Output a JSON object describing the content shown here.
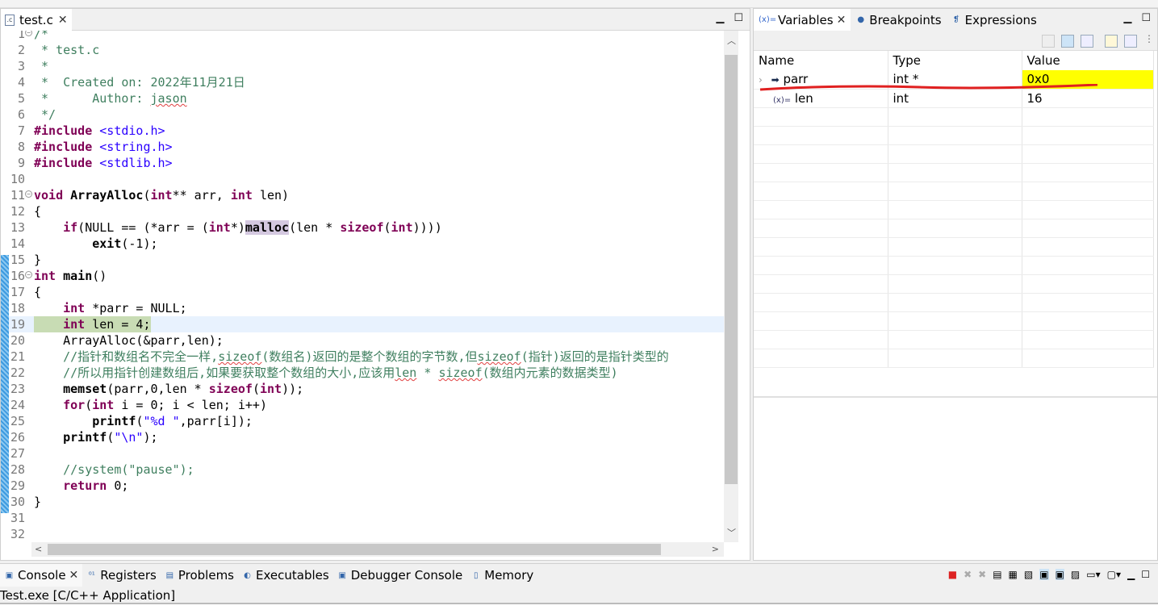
{
  "editor": {
    "tab_label": "test.c",
    "file_icon": "c-file-icon",
    "lines": [
      [
        {
          "c": "cm",
          "s": "/*"
        }
      ],
      [
        {
          "c": "cm",
          "s": " * test.c"
        }
      ],
      [
        {
          "c": "cm",
          "s": " *"
        }
      ],
      [
        {
          "c": "cm",
          "s": " *  Created on: 2022年11月21日"
        }
      ],
      [
        {
          "c": "cm",
          "s": " *      Author: "
        },
        {
          "c": "cm sq",
          "s": "jason"
        }
      ],
      [
        {
          "c": "cm",
          "s": " */"
        }
      ],
      [
        {
          "c": "kw",
          "s": "#include"
        },
        {
          "c": "",
          "s": " "
        },
        {
          "c": "st",
          "s": "<stdio.h>"
        }
      ],
      [
        {
          "c": "kw",
          "s": "#include"
        },
        {
          "c": "",
          "s": " "
        },
        {
          "c": "st",
          "s": "<string.h>"
        }
      ],
      [
        {
          "c": "kw",
          "s": "#include"
        },
        {
          "c": "",
          "s": " "
        },
        {
          "c": "st",
          "s": "<stdlib.h>"
        }
      ],
      [],
      [
        {
          "c": "kw",
          "s": "void"
        },
        {
          "c": "",
          "s": " "
        },
        {
          "c": "fn",
          "s": "ArrayAlloc"
        },
        {
          "c": "",
          "s": "("
        },
        {
          "c": "kw",
          "s": "int"
        },
        {
          "c": "",
          "s": "** arr, "
        },
        {
          "c": "kw",
          "s": "int"
        },
        {
          "c": "",
          "s": " len)"
        }
      ],
      [
        {
          "c": "",
          "s": "{"
        }
      ],
      [
        {
          "c": "",
          "s": "    "
        },
        {
          "c": "kw",
          "s": "if"
        },
        {
          "c": "",
          "s": "(NULL == (*arr = ("
        },
        {
          "c": "kw",
          "s": "int"
        },
        {
          "c": "",
          "s": "*)"
        },
        {
          "c": "fn hl",
          "s": "malloc"
        },
        {
          "c": "",
          "s": "(len * "
        },
        {
          "c": "kw",
          "s": "sizeof"
        },
        {
          "c": "",
          "s": "("
        },
        {
          "c": "kw",
          "s": "int"
        },
        {
          "c": "",
          "s": "))))"
        }
      ],
      [
        {
          "c": "",
          "s": "        "
        },
        {
          "c": "fn",
          "s": "exit"
        },
        {
          "c": "",
          "s": "(-1);"
        }
      ],
      [
        {
          "c": "",
          "s": "}"
        }
      ],
      [
        {
          "c": "kw",
          "s": "int"
        },
        {
          "c": "",
          "s": " "
        },
        {
          "c": "fn",
          "s": "main"
        },
        {
          "c": "",
          "s": "()"
        }
      ],
      [
        {
          "c": "",
          "s": "{"
        }
      ],
      [
        {
          "c": "",
          "s": "    "
        },
        {
          "c": "kw",
          "s": "int"
        },
        {
          "c": "",
          "s": " *parr = NULL;"
        }
      ],
      [
        {
          "c": "",
          "s": "    "
        },
        {
          "c": "kw",
          "s": "int"
        },
        {
          "c": "",
          "s": " len = 4;"
        }
      ],
      [
        {
          "c": "",
          "s": "    ArrayAlloc(&parr,len);"
        }
      ],
      [
        {
          "c": "cm",
          "s": "    //指针和数组名不完全一样,"
        },
        {
          "c": "cm sq",
          "s": "sizeof"
        },
        {
          "c": "cm",
          "s": "(数组名)返回的是整个数组的字节数,但"
        },
        {
          "c": "cm sq",
          "s": "sizeof"
        },
        {
          "c": "cm",
          "s": "(指针)返回的是指针类型的"
        }
      ],
      [
        {
          "c": "cm",
          "s": "    //所以用指针创建数组后,如果要获取整个数组的大小,应该用"
        },
        {
          "c": "cm sq",
          "s": "len"
        },
        {
          "c": "cm",
          "s": " * "
        },
        {
          "c": "cm sq",
          "s": "sizeof"
        },
        {
          "c": "cm",
          "s": "(数组内元素的数据类型)"
        }
      ],
      [
        {
          "c": "",
          "s": "    "
        },
        {
          "c": "fn",
          "s": "memset"
        },
        {
          "c": "",
          "s": "(parr,0,len * "
        },
        {
          "c": "kw",
          "s": "sizeof"
        },
        {
          "c": "",
          "s": "("
        },
        {
          "c": "kw",
          "s": "int"
        },
        {
          "c": "",
          "s": "));"
        }
      ],
      [
        {
          "c": "",
          "s": "    "
        },
        {
          "c": "kw",
          "s": "for"
        },
        {
          "c": "",
          "s": "("
        },
        {
          "c": "kw",
          "s": "int"
        },
        {
          "c": "",
          "s": " i = 0; i < len; i++)"
        }
      ],
      [
        {
          "c": "",
          "s": "        "
        },
        {
          "c": "fn",
          "s": "printf"
        },
        {
          "c": "",
          "s": "("
        },
        {
          "c": "st",
          "s": "\"%d \""
        },
        {
          "c": "",
          "s": ",parr[i]);"
        }
      ],
      [
        {
          "c": "",
          "s": "    "
        },
        {
          "c": "fn",
          "s": "printf"
        },
        {
          "c": "",
          "s": "("
        },
        {
          "c": "st",
          "s": "\"\\n\""
        },
        {
          "c": "",
          "s": ");"
        }
      ],
      [],
      [
        {
          "c": "cm",
          "s": "    //system(\"pause\");"
        }
      ],
      [
        {
          "c": "",
          "s": "    "
        },
        {
          "c": "kw",
          "s": "return"
        },
        {
          "c": "",
          "s": " 0;"
        }
      ],
      [
        {
          "c": "",
          "s": "}"
        }
      ],
      [],
      []
    ],
    "current_line": 19,
    "fold_lines": [
      1,
      11,
      16
    ]
  },
  "variables": {
    "tabs": [
      {
        "label": "Variables",
        "icon": "variables-icon"
      },
      {
        "label": "Breakpoints",
        "icon": "breakpoints-icon"
      },
      {
        "label": "Expressions",
        "icon": "expressions-icon"
      }
    ],
    "columns": [
      "Name",
      "Type",
      "Value"
    ],
    "rows": [
      {
        "name": "parr",
        "type": "int *",
        "value": "0x0",
        "icon": "pointer-arrow-icon",
        "changed": true
      },
      {
        "name": "len",
        "type": "int",
        "value": "16",
        "icon": "variable-icon",
        "changed": false
      }
    ],
    "highlight_color": "#ffff00",
    "annotation_color": "#e02020"
  },
  "console": {
    "tabs": [
      "Console",
      "Registers",
      "Problems",
      "Executables",
      "Debugger Console",
      "Memory"
    ],
    "tab_icons": [
      "console-icon",
      "registers-icon",
      "problems-icon",
      "executables-icon",
      "debugger-console-icon",
      "memory-icon"
    ],
    "title": "Test.exe [C/C++ Application]"
  }
}
